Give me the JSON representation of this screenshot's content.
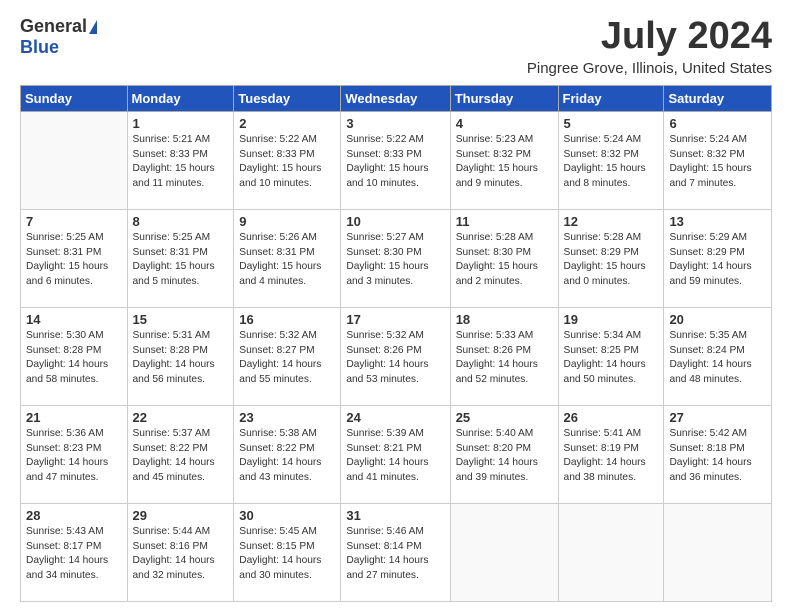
{
  "logo": {
    "general": "General",
    "blue": "Blue"
  },
  "title": "July 2024",
  "location": "Pingree Grove, Illinois, United States",
  "days_of_week": [
    "Sunday",
    "Monday",
    "Tuesday",
    "Wednesday",
    "Thursday",
    "Friday",
    "Saturday"
  ],
  "weeks": [
    [
      {
        "day": "",
        "text": ""
      },
      {
        "day": "1",
        "text": "Sunrise: 5:21 AM\nSunset: 8:33 PM\nDaylight: 15 hours\nand 11 minutes."
      },
      {
        "day": "2",
        "text": "Sunrise: 5:22 AM\nSunset: 8:33 PM\nDaylight: 15 hours\nand 10 minutes."
      },
      {
        "day": "3",
        "text": "Sunrise: 5:22 AM\nSunset: 8:33 PM\nDaylight: 15 hours\nand 10 minutes."
      },
      {
        "day": "4",
        "text": "Sunrise: 5:23 AM\nSunset: 8:32 PM\nDaylight: 15 hours\nand 9 minutes."
      },
      {
        "day": "5",
        "text": "Sunrise: 5:24 AM\nSunset: 8:32 PM\nDaylight: 15 hours\nand 8 minutes."
      },
      {
        "day": "6",
        "text": "Sunrise: 5:24 AM\nSunset: 8:32 PM\nDaylight: 15 hours\nand 7 minutes."
      }
    ],
    [
      {
        "day": "7",
        "text": "Sunrise: 5:25 AM\nSunset: 8:31 PM\nDaylight: 15 hours\nand 6 minutes."
      },
      {
        "day": "8",
        "text": "Sunrise: 5:25 AM\nSunset: 8:31 PM\nDaylight: 15 hours\nand 5 minutes."
      },
      {
        "day": "9",
        "text": "Sunrise: 5:26 AM\nSunset: 8:31 PM\nDaylight: 15 hours\nand 4 minutes."
      },
      {
        "day": "10",
        "text": "Sunrise: 5:27 AM\nSunset: 8:30 PM\nDaylight: 15 hours\nand 3 minutes."
      },
      {
        "day": "11",
        "text": "Sunrise: 5:28 AM\nSunset: 8:30 PM\nDaylight: 15 hours\nand 2 minutes."
      },
      {
        "day": "12",
        "text": "Sunrise: 5:28 AM\nSunset: 8:29 PM\nDaylight: 15 hours\nand 0 minutes."
      },
      {
        "day": "13",
        "text": "Sunrise: 5:29 AM\nSunset: 8:29 PM\nDaylight: 14 hours\nand 59 minutes."
      }
    ],
    [
      {
        "day": "14",
        "text": "Sunrise: 5:30 AM\nSunset: 8:28 PM\nDaylight: 14 hours\nand 58 minutes."
      },
      {
        "day": "15",
        "text": "Sunrise: 5:31 AM\nSunset: 8:28 PM\nDaylight: 14 hours\nand 56 minutes."
      },
      {
        "day": "16",
        "text": "Sunrise: 5:32 AM\nSunset: 8:27 PM\nDaylight: 14 hours\nand 55 minutes."
      },
      {
        "day": "17",
        "text": "Sunrise: 5:32 AM\nSunset: 8:26 PM\nDaylight: 14 hours\nand 53 minutes."
      },
      {
        "day": "18",
        "text": "Sunrise: 5:33 AM\nSunset: 8:26 PM\nDaylight: 14 hours\nand 52 minutes."
      },
      {
        "day": "19",
        "text": "Sunrise: 5:34 AM\nSunset: 8:25 PM\nDaylight: 14 hours\nand 50 minutes."
      },
      {
        "day": "20",
        "text": "Sunrise: 5:35 AM\nSunset: 8:24 PM\nDaylight: 14 hours\nand 48 minutes."
      }
    ],
    [
      {
        "day": "21",
        "text": "Sunrise: 5:36 AM\nSunset: 8:23 PM\nDaylight: 14 hours\nand 47 minutes."
      },
      {
        "day": "22",
        "text": "Sunrise: 5:37 AM\nSunset: 8:22 PM\nDaylight: 14 hours\nand 45 minutes."
      },
      {
        "day": "23",
        "text": "Sunrise: 5:38 AM\nSunset: 8:22 PM\nDaylight: 14 hours\nand 43 minutes."
      },
      {
        "day": "24",
        "text": "Sunrise: 5:39 AM\nSunset: 8:21 PM\nDaylight: 14 hours\nand 41 minutes."
      },
      {
        "day": "25",
        "text": "Sunrise: 5:40 AM\nSunset: 8:20 PM\nDaylight: 14 hours\nand 39 minutes."
      },
      {
        "day": "26",
        "text": "Sunrise: 5:41 AM\nSunset: 8:19 PM\nDaylight: 14 hours\nand 38 minutes."
      },
      {
        "day": "27",
        "text": "Sunrise: 5:42 AM\nSunset: 8:18 PM\nDaylight: 14 hours\nand 36 minutes."
      }
    ],
    [
      {
        "day": "28",
        "text": "Sunrise: 5:43 AM\nSunset: 8:17 PM\nDaylight: 14 hours\nand 34 minutes."
      },
      {
        "day": "29",
        "text": "Sunrise: 5:44 AM\nSunset: 8:16 PM\nDaylight: 14 hours\nand 32 minutes."
      },
      {
        "day": "30",
        "text": "Sunrise: 5:45 AM\nSunset: 8:15 PM\nDaylight: 14 hours\nand 30 minutes."
      },
      {
        "day": "31",
        "text": "Sunrise: 5:46 AM\nSunset: 8:14 PM\nDaylight: 14 hours\nand 27 minutes."
      },
      {
        "day": "",
        "text": ""
      },
      {
        "day": "",
        "text": ""
      },
      {
        "day": "",
        "text": ""
      }
    ]
  ]
}
